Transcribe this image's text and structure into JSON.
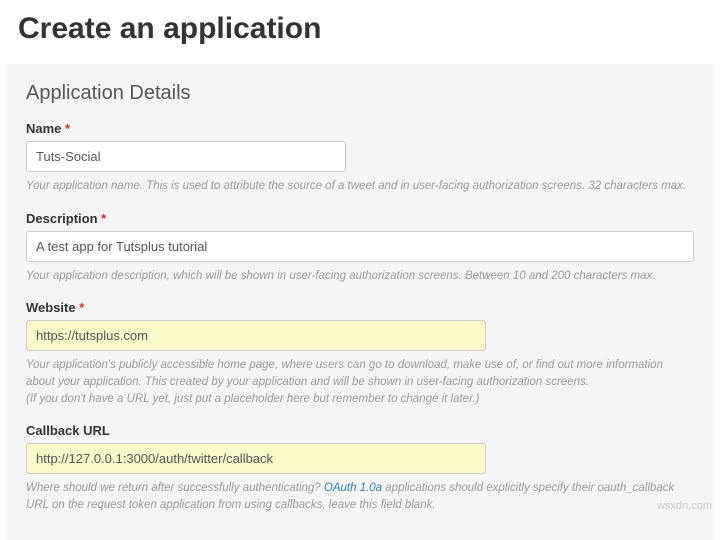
{
  "page": {
    "title": "Create an application"
  },
  "panel": {
    "heading": "Application Details"
  },
  "fields": {
    "name": {
      "label": "Name",
      "required": "*",
      "value": "Tuts-Social",
      "help": "Your application name. This is used to attribute the source of a tweet and in user-facing authorization screens. 32 characters max."
    },
    "description": {
      "label": "Description",
      "required": "*",
      "value": "A test app for Tutsplus tutorial",
      "help": "Your application description, which will be shown in user-facing authorization screens. Between 10 and 200 characters max."
    },
    "website": {
      "label": "Website",
      "required": "*",
      "value": "https://tutsplus.com",
      "help1": "Your application's publicly accessible home page, where users can go to download, make use of, or find out more information about your application. This created by your application and will be shown in user-facing authorization screens.",
      "help2": "(If you don't have a URL yet, just put a placeholder here but remember to change it later.)"
    },
    "callback": {
      "label": "Callback URL",
      "value": "http://127.0.0.1:3000/auth/twitter/callback",
      "help_pre": "Where should we return after successfully authenticating? ",
      "help_link": "OAuth 1.0a",
      "help_post": " applications should explicitly specify their oauth_callback URL on the request token application from using callbacks, leave this field blank."
    }
  },
  "watermark": "wsxdn.com"
}
